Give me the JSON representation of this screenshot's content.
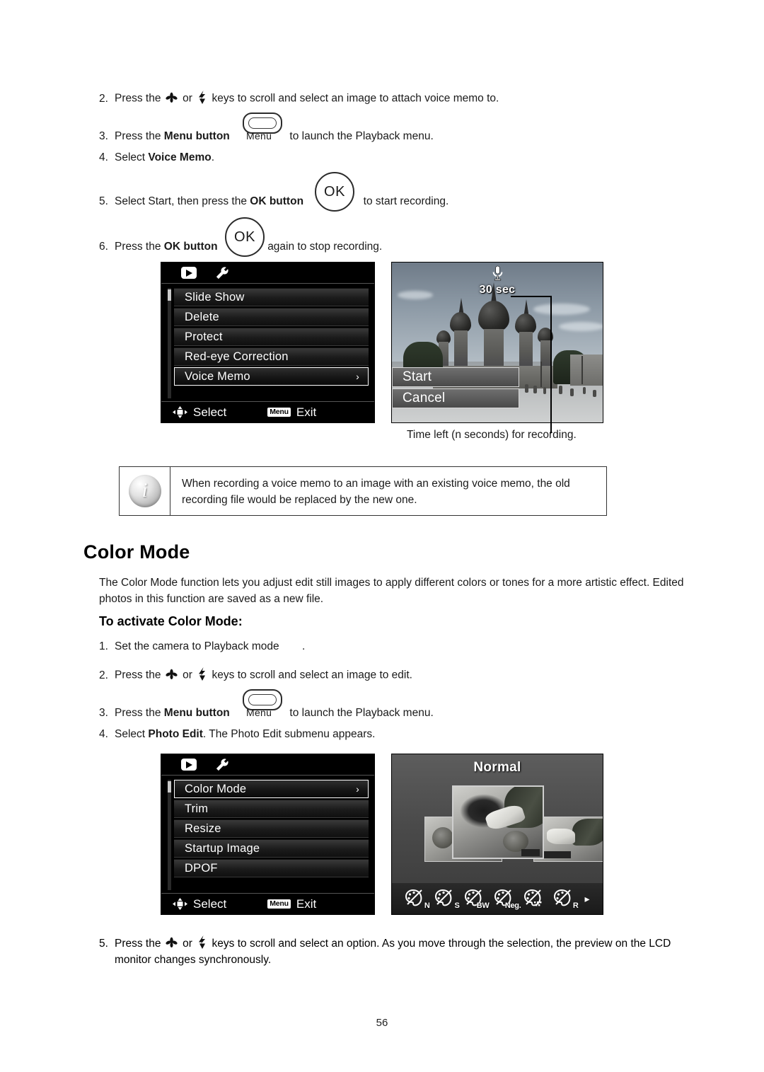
{
  "document": {
    "page_number": "56"
  },
  "voice_memo_steps": {
    "step2": {
      "num": "2.",
      "pre": "Press the",
      "mid": "or",
      "post": "keys to scroll and select an image to attach voice memo to."
    },
    "step3": {
      "num": "3.",
      "pre": "Press the",
      "bold": "Menu button",
      "button_label": "Menu",
      "post": "to launch the Playback menu."
    },
    "step4": {
      "num": "4.",
      "pre": "Select",
      "bold": "Voice Memo",
      "post": "."
    },
    "step5": {
      "num": "5.",
      "pre": "Select Start, then press the",
      "bold": "OK button",
      "button_label": "OK",
      "post": "to start recording."
    },
    "step6": {
      "num": "6.",
      "pre": "Press the",
      "bold": "OK button",
      "button_label": "OK",
      "post": "again to stop recording."
    }
  },
  "playback_menu": {
    "tabs": [
      {
        "name": "playback-tab",
        "icon": "playback-icon"
      },
      {
        "name": "setup-tab",
        "icon": "wrench-icon"
      }
    ],
    "items": [
      {
        "label": "Slide Show",
        "selected": false,
        "arrow": ""
      },
      {
        "label": "Delete",
        "selected": false,
        "arrow": ""
      },
      {
        "label": "Protect",
        "selected": false,
        "arrow": ""
      },
      {
        "label": "Red-eye Correction",
        "selected": false,
        "arrow": ""
      },
      {
        "label": "Voice Memo",
        "selected": true,
        "arrow": "›"
      }
    ],
    "footer": {
      "select_label": "Select",
      "menu_badge": "Menu",
      "exit_label": "Exit"
    }
  },
  "voice_memo_screen": {
    "timer": "30 sec",
    "mic_icon": "microphone-icon",
    "options": [
      {
        "label": "Start"
      },
      {
        "label": "Cancel"
      }
    ],
    "caption": "Time left (n seconds) for recording."
  },
  "note": {
    "icon": "info-icon",
    "glyph": "i",
    "text": "When recording a voice memo to an image with an existing voice memo, the old recording file would be replaced by the new one."
  },
  "color_mode_section": {
    "heading": "Color Mode",
    "intro": "The Color Mode function lets you adjust edit still images to apply different colors or tones for a more artistic effect. Edited photos in this function are saved as a new file.",
    "subheading": "To activate Color Mode:",
    "steps": {
      "step1": {
        "num": "1.",
        "pre": "Set the camera to Playback mode",
        "post": "."
      },
      "step2": {
        "num": "2.",
        "pre": "Press the",
        "mid": "or",
        "post": "keys to scroll and select an image to edit."
      },
      "step3": {
        "num": "3.",
        "pre": "Press the",
        "bold": "Menu button",
        "button_label": "Menu",
        "post": "to launch the Playback menu."
      },
      "step4": {
        "num": "4.",
        "pre": "Select",
        "bold": "Photo Edit",
        "post": ". The Photo Edit submenu appears."
      },
      "step5": {
        "num": "5.",
        "pre": "Press the",
        "mid": "or",
        "post": "keys to scroll and select an option. As you move through the selection, the preview on the LCD monitor changes synchronously."
      }
    }
  },
  "photo_edit_menu": {
    "tabs": [
      {
        "name": "playback-tab",
        "icon": "playback-icon"
      },
      {
        "name": "setup-tab",
        "icon": "wrench-icon"
      }
    ],
    "items": [
      {
        "label": "Color Mode",
        "selected": true,
        "arrow": "›"
      },
      {
        "label": "Trim",
        "selected": false,
        "arrow": ""
      },
      {
        "label": "Resize",
        "selected": false,
        "arrow": ""
      },
      {
        "label": "Startup Image",
        "selected": false,
        "arrow": ""
      },
      {
        "label": "DPOF",
        "selected": false,
        "arrow": ""
      }
    ],
    "footer": {
      "select_label": "Select",
      "menu_badge": "Menu",
      "exit_label": "Exit"
    }
  },
  "color_preview_screen": {
    "title": "Normal",
    "mode_icons": [
      {
        "label": "N",
        "name": "color-mode-normal-icon"
      },
      {
        "label": "S",
        "name": "color-mode-sepia-icon"
      },
      {
        "label": "BW",
        "name": "color-mode-blackwhite-icon"
      },
      {
        "label": "Neg.",
        "name": "color-mode-negative-icon"
      },
      {
        "label": "",
        "name": "color-mode-mosaic-icon"
      },
      {
        "label": "R",
        "name": "color-mode-red-icon"
      }
    ],
    "next_arrow": "▸"
  }
}
